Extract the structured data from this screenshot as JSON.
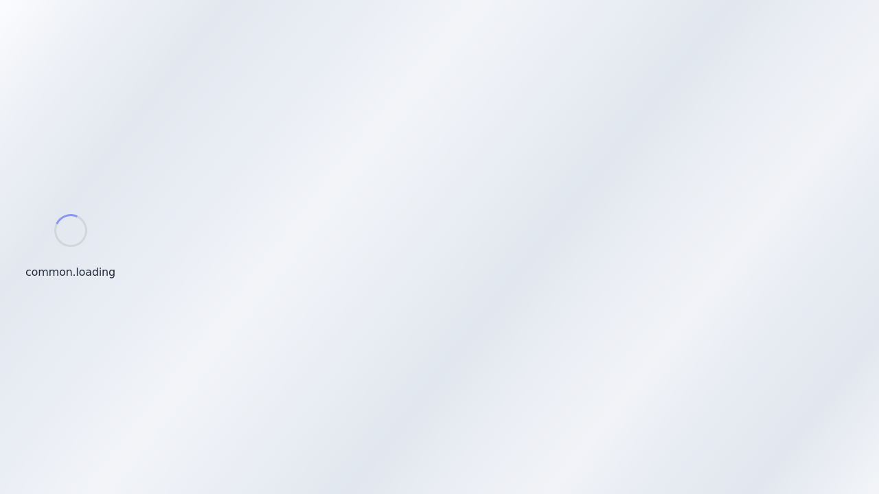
{
  "loading": {
    "text": "common.loading",
    "spinner_icon": "loading-spinner-icon"
  },
  "colors": {
    "spinner_track": "#d1d5dc",
    "spinner_accent": "#8b97ee",
    "text": "#1f2937"
  }
}
